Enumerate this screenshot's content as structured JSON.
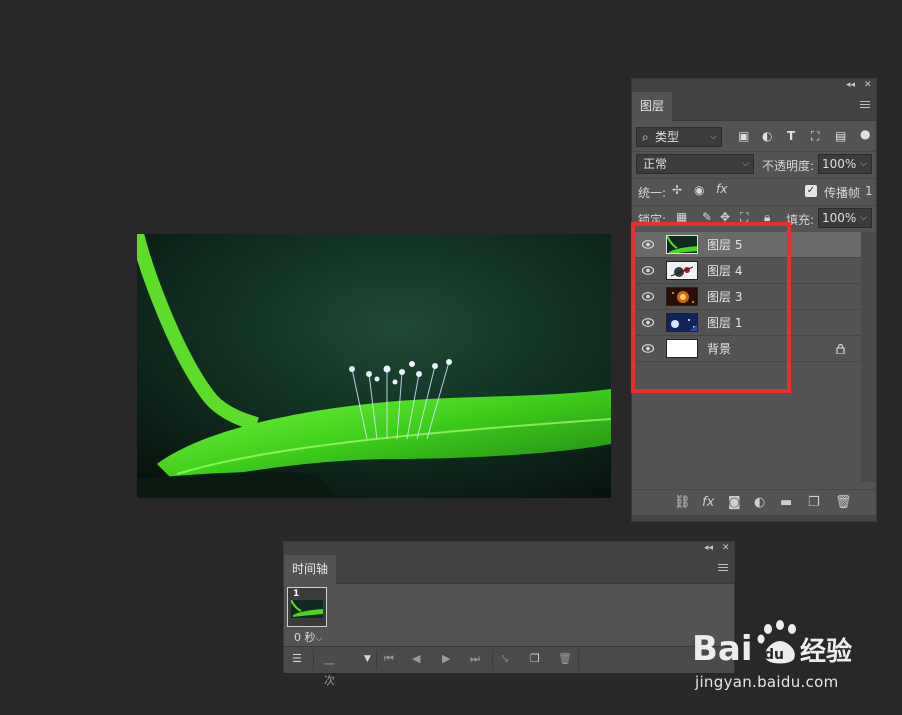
{
  "layers_panel": {
    "tab_label": "图层",
    "filter_kind": "类型",
    "blend_mode": "正常",
    "opacity_label": "不透明度:",
    "opacity_value": "100%",
    "unify_label": "统一:",
    "propagate_label": "传播帧",
    "propagate_value": "1",
    "lock_label": "锁定:",
    "fill_label": "填充:",
    "fill_value": "100%",
    "layers": [
      {
        "name": "图层 5",
        "selected": true,
        "thumb": "leaf",
        "locked": false
      },
      {
        "name": "图层 4",
        "selected": false,
        "thumb": "calligraphy",
        "locked": false
      },
      {
        "name": "图层 3",
        "selected": false,
        "thumb": "fire",
        "locked": false
      },
      {
        "name": "图层 1",
        "selected": false,
        "thumb": "night",
        "locked": false
      },
      {
        "name": "背景",
        "selected": false,
        "thumb": "white",
        "locked": true
      }
    ],
    "footer_fx": "fx"
  },
  "timeline_panel": {
    "tab_label": "时间轴",
    "frame_number": "1",
    "frame_delay": "0 秒",
    "loop_option": "一次"
  },
  "watermark": {
    "brand_latin": "Bai",
    "brand_cn": "经验",
    "url": "jingyan.baidu.com"
  },
  "colors": {
    "background": "#282828",
    "panel": "#535353",
    "highlight_box": "#e8302a",
    "selected_row": "#6a6a6a"
  }
}
